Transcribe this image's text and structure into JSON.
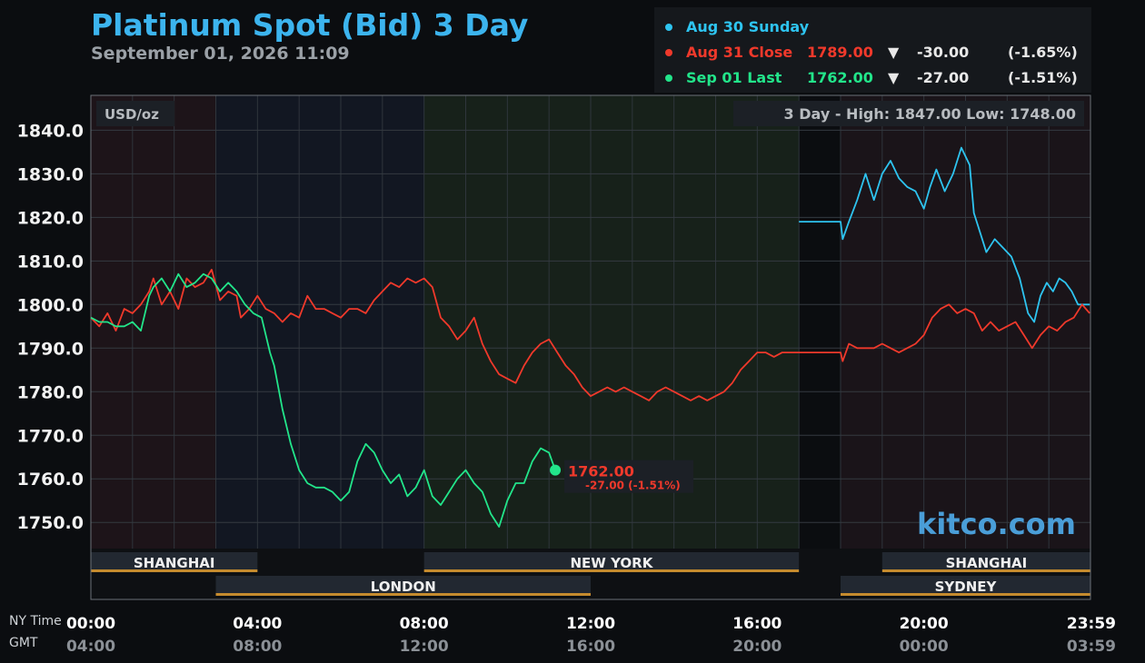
{
  "header": {
    "title": "Platinum Spot (Bid) 3 Day",
    "subtitle": "September 01, 2026 11:09"
  },
  "legend": [
    {
      "label": "Aug 30 Sunday",
      "price": "",
      "arrow": "",
      "change": "",
      "pct": "",
      "color": "#2ec4f0"
    },
    {
      "label": "Aug 31 Close",
      "price": "1789.00",
      "arrow": "▼",
      "change": "-30.00",
      "pct": "(-1.65%)",
      "color": "#f0392b"
    },
    {
      "label": "Sep 01 Last",
      "price": "1762.00",
      "arrow": "▼",
      "change": "-27.00",
      "pct": "(-1.51%)",
      "color": "#22e58a"
    }
  ],
  "footer": {
    "ny_label": "NY Time",
    "gmt_label": "GMT"
  },
  "chart_data": {
    "type": "line",
    "unit_label": "USD/oz",
    "range_text": "3 Day - High: 1847.00  Low: 1748.00",
    "watermark": "kitco.com",
    "ylim": [
      1744,
      1848
    ],
    "y_ticks": [
      "1840.0",
      "1830.0",
      "1820.0",
      "1810.0",
      "1800.0",
      "1790.0",
      "1780.0",
      "1770.0",
      "1760.0",
      "1750.0"
    ],
    "x_ticks": [
      {
        "hour": 0,
        "ny": "00:00",
        "gmt": "04:00"
      },
      {
        "hour": 4,
        "ny": "04:00",
        "gmt": "08:00"
      },
      {
        "hour": 8,
        "ny": "08:00",
        "gmt": "12:00"
      },
      {
        "hour": 12,
        "ny": "12:00",
        "gmt": "16:00"
      },
      {
        "hour": 16,
        "ny": "16:00",
        "gmt": "20:00"
      },
      {
        "hour": 20,
        "ny": "20:00",
        "gmt": "00:00"
      },
      {
        "hour": 23.98,
        "ny": "23:59",
        "gmt": "03:59"
      }
    ],
    "sessions": [
      {
        "name": "SHANGHAI",
        "start": 0,
        "end": 4,
        "row": 1
      },
      {
        "name": "NEW YORK",
        "start": 8,
        "end": 17,
        "row": 1
      },
      {
        "name": "SHANGHAI",
        "start": 19,
        "end": 24,
        "row": 1
      },
      {
        "name": "LONDON",
        "start": 3,
        "end": 12,
        "row": 2
      },
      {
        "name": "SYDNEY",
        "start": 18,
        "end": 24,
        "row": 2
      }
    ],
    "last_point": {
      "hour": 11.15,
      "value": 1762,
      "price_label": "1762.00",
      "change_label": "-27.00 (-1.51%)"
    },
    "series": [
      {
        "name": "Aug 30 Sunday",
        "color": "#2ec4f0",
        "points": [
          [
            17,
            1819
          ],
          [
            18,
            1819
          ],
          [
            18.05,
            1815
          ],
          [
            18.2,
            1819
          ],
          [
            18.4,
            1824
          ],
          [
            18.6,
            1830
          ],
          [
            18.8,
            1824
          ],
          [
            19,
            1830
          ],
          [
            19.2,
            1833
          ],
          [
            19.4,
            1829
          ],
          [
            19.6,
            1827
          ],
          [
            19.8,
            1826
          ],
          [
            20,
            1822
          ],
          [
            20.15,
            1827
          ],
          [
            20.3,
            1831
          ],
          [
            20.5,
            1826
          ],
          [
            20.7,
            1830
          ],
          [
            20.9,
            1836
          ],
          [
            21.1,
            1832
          ],
          [
            21.2,
            1821
          ],
          [
            21.3,
            1818
          ],
          [
            21.5,
            1812
          ],
          [
            21.7,
            1815
          ],
          [
            21.9,
            1813
          ],
          [
            22.1,
            1811
          ],
          [
            22.3,
            1806
          ],
          [
            22.5,
            1798
          ],
          [
            22.65,
            1796
          ],
          [
            22.8,
            1802
          ],
          [
            22.95,
            1805
          ],
          [
            23.1,
            1803
          ],
          [
            23.25,
            1806
          ],
          [
            23.4,
            1805
          ],
          [
            23.55,
            1803
          ],
          [
            23.7,
            1800
          ],
          [
            23.98,
            1800
          ]
        ]
      },
      {
        "name": "Aug 31 Close",
        "color": "#f0392b",
        "points": [
          [
            0,
            1797
          ],
          [
            0.2,
            1795
          ],
          [
            0.4,
            1798
          ],
          [
            0.6,
            1794
          ],
          [
            0.8,
            1799
          ],
          [
            1,
            1798
          ],
          [
            1.2,
            1800
          ],
          [
            1.4,
            1803
          ],
          [
            1.5,
            1806
          ],
          [
            1.7,
            1800
          ],
          [
            1.9,
            1803
          ],
          [
            2.1,
            1799
          ],
          [
            2.3,
            1806
          ],
          [
            2.5,
            1804
          ],
          [
            2.7,
            1805
          ],
          [
            2.9,
            1808
          ],
          [
            3.1,
            1801
          ],
          [
            3.3,
            1803
          ],
          [
            3.5,
            1802
          ],
          [
            3.6,
            1797
          ],
          [
            3.8,
            1799
          ],
          [
            4,
            1802
          ],
          [
            4.2,
            1799
          ],
          [
            4.4,
            1798
          ],
          [
            4.6,
            1796
          ],
          [
            4.8,
            1798
          ],
          [
            5,
            1797
          ],
          [
            5.2,
            1802
          ],
          [
            5.4,
            1799
          ],
          [
            5.6,
            1799
          ],
          [
            5.8,
            1798
          ],
          [
            6,
            1797
          ],
          [
            6.2,
            1799
          ],
          [
            6.4,
            1799
          ],
          [
            6.6,
            1798
          ],
          [
            6.8,
            1801
          ],
          [
            7,
            1803
          ],
          [
            7.2,
            1805
          ],
          [
            7.4,
            1804
          ],
          [
            7.6,
            1806
          ],
          [
            7.8,
            1805
          ],
          [
            8,
            1806
          ],
          [
            8.2,
            1804
          ],
          [
            8.4,
            1797
          ],
          [
            8.6,
            1795
          ],
          [
            8.8,
            1792
          ],
          [
            9,
            1794
          ],
          [
            9.2,
            1797
          ],
          [
            9.4,
            1791
          ],
          [
            9.6,
            1787
          ],
          [
            9.8,
            1784
          ],
          [
            10,
            1783
          ],
          [
            10.2,
            1782
          ],
          [
            10.4,
            1786
          ],
          [
            10.6,
            1789
          ],
          [
            10.8,
            1791
          ],
          [
            11,
            1792
          ],
          [
            11.2,
            1789
          ],
          [
            11.4,
            1786
          ],
          [
            11.6,
            1784
          ],
          [
            11.8,
            1781
          ],
          [
            12,
            1779
          ],
          [
            12.2,
            1780
          ],
          [
            12.4,
            1781
          ],
          [
            12.6,
            1780
          ],
          [
            12.8,
            1781
          ],
          [
            13,
            1780
          ],
          [
            13.2,
            1779
          ],
          [
            13.4,
            1778
          ],
          [
            13.6,
            1780
          ],
          [
            13.8,
            1781
          ],
          [
            14,
            1780
          ],
          [
            14.2,
            1779
          ],
          [
            14.4,
            1778
          ],
          [
            14.6,
            1779
          ],
          [
            14.8,
            1778
          ],
          [
            15,
            1779
          ],
          [
            15.2,
            1780
          ],
          [
            15.4,
            1782
          ],
          [
            15.6,
            1785
          ],
          [
            15.8,
            1787
          ],
          [
            16,
            1789
          ],
          [
            16.2,
            1789
          ],
          [
            16.4,
            1788
          ],
          [
            16.6,
            1789
          ],
          [
            16.8,
            1789
          ],
          [
            17,
            1789
          ],
          [
            18,
            1789
          ],
          [
            18.05,
            1787
          ],
          [
            18.2,
            1791
          ],
          [
            18.4,
            1790
          ],
          [
            18.6,
            1790
          ],
          [
            18.8,
            1790
          ],
          [
            19,
            1791
          ],
          [
            19.2,
            1790
          ],
          [
            19.4,
            1789
          ],
          [
            19.6,
            1790
          ],
          [
            19.8,
            1791
          ],
          [
            20,
            1793
          ],
          [
            20.2,
            1797
          ],
          [
            20.4,
            1799
          ],
          [
            20.6,
            1800
          ],
          [
            20.8,
            1798
          ],
          [
            21,
            1799
          ],
          [
            21.2,
            1798
          ],
          [
            21.4,
            1794
          ],
          [
            21.6,
            1796
          ],
          [
            21.8,
            1794
          ],
          [
            22,
            1795
          ],
          [
            22.2,
            1796
          ],
          [
            22.4,
            1793
          ],
          [
            22.6,
            1790
          ],
          [
            22.8,
            1793
          ],
          [
            23,
            1795
          ],
          [
            23.2,
            1794
          ],
          [
            23.4,
            1796
          ],
          [
            23.6,
            1797
          ],
          [
            23.8,
            1800
          ],
          [
            23.98,
            1798
          ]
        ]
      },
      {
        "name": "Sep 01 Last",
        "color": "#22e58a",
        "points": [
          [
            0,
            1797
          ],
          [
            0.2,
            1796
          ],
          [
            0.4,
            1796
          ],
          [
            0.6,
            1795
          ],
          [
            0.8,
            1795
          ],
          [
            1,
            1796
          ],
          [
            1.2,
            1794
          ],
          [
            1.4,
            1802
          ],
          [
            1.5,
            1804
          ],
          [
            1.7,
            1806
          ],
          [
            1.9,
            1803
          ],
          [
            2.1,
            1807
          ],
          [
            2.3,
            1804
          ],
          [
            2.5,
            1805
          ],
          [
            2.7,
            1807
          ],
          [
            2.9,
            1806
          ],
          [
            3.1,
            1803
          ],
          [
            3.3,
            1805
          ],
          [
            3.5,
            1803
          ],
          [
            3.7,
            1800
          ],
          [
            3.9,
            1798
          ],
          [
            4.1,
            1797
          ],
          [
            4.2,
            1793
          ],
          [
            4.3,
            1789
          ],
          [
            4.4,
            1786
          ],
          [
            4.6,
            1776
          ],
          [
            4.8,
            1768
          ],
          [
            5,
            1762
          ],
          [
            5.2,
            1759
          ],
          [
            5.4,
            1758
          ],
          [
            5.6,
            1758
          ],
          [
            5.8,
            1757
          ],
          [
            6,
            1755
          ],
          [
            6.2,
            1757
          ],
          [
            6.4,
            1764
          ],
          [
            6.6,
            1768
          ],
          [
            6.8,
            1766
          ],
          [
            7,
            1762
          ],
          [
            7.2,
            1759
          ],
          [
            7.4,
            1761
          ],
          [
            7.6,
            1756
          ],
          [
            7.8,
            1758
          ],
          [
            8,
            1762
          ],
          [
            8.2,
            1756
          ],
          [
            8.4,
            1754
          ],
          [
            8.6,
            1757
          ],
          [
            8.8,
            1760
          ],
          [
            9,
            1762
          ],
          [
            9.2,
            1759
          ],
          [
            9.4,
            1757
          ],
          [
            9.6,
            1752
          ],
          [
            9.8,
            1749
          ],
          [
            10,
            1755
          ],
          [
            10.2,
            1759
          ],
          [
            10.4,
            1759
          ],
          [
            10.6,
            1764
          ],
          [
            10.8,
            1767
          ],
          [
            11,
            1766
          ],
          [
            11.15,
            1762
          ]
        ]
      }
    ]
  }
}
